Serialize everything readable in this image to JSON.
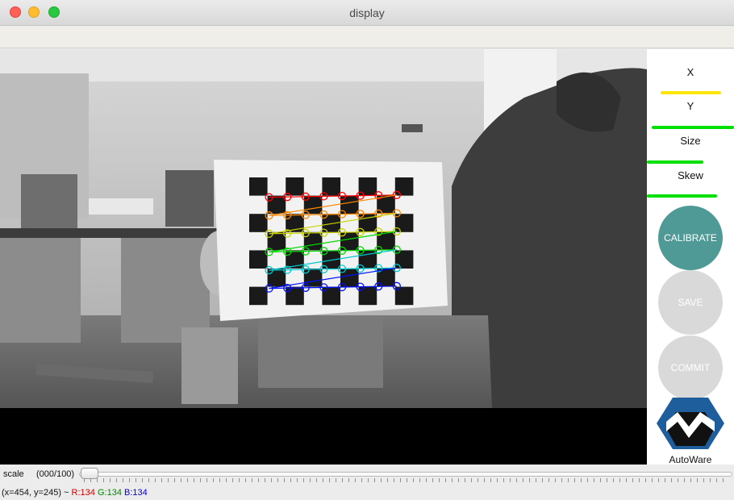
{
  "window": {
    "title": "display"
  },
  "panel": {
    "labels": {
      "x": "X",
      "y": "Y",
      "size": "Size",
      "skew": "Skew"
    },
    "bar_colors": {
      "x": "#ffe600",
      "y": "#00e000",
      "size": "#00e000",
      "skew": "#00e000"
    },
    "buttons": {
      "calibrate": "CALIBRATE",
      "save": "SAVE",
      "commit": "COMMIT"
    },
    "button_colors": {
      "active": "#4f9a97",
      "disabled": "#d9d9d9"
    },
    "logo_text": "AutoWare"
  },
  "slider": {
    "label": "scale",
    "value": "(000/100)"
  },
  "status": {
    "coords": "(x=454, y=245) ~",
    "r": "R:134",
    "g": "G:134",
    "b": "B:134"
  },
  "detection": {
    "row_colors": [
      "#ff0000",
      "#ff8800",
      "#c8d400",
      "#00d800",
      "#00c8d0",
      "#0010ff"
    ],
    "rows": 6,
    "cols": 8
  }
}
